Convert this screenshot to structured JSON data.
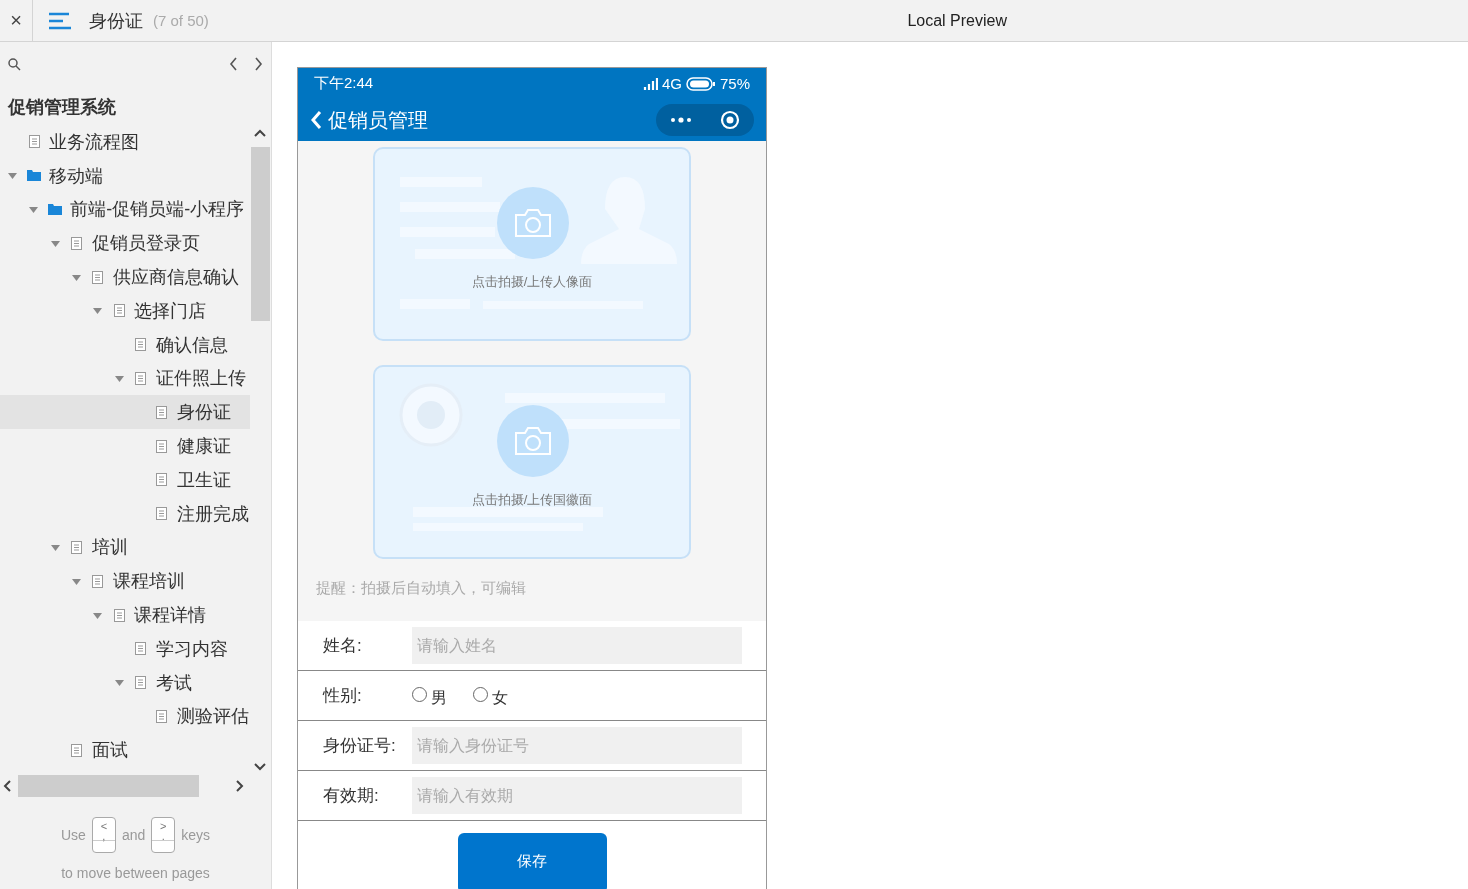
{
  "header": {
    "close": "×",
    "page_title": "身份证",
    "page_count": "(7 of 50)",
    "preview_title": "Local Preview"
  },
  "sidebar": {
    "project_title": "促销管理系统",
    "tree": [
      {
        "label": "业务流程图",
        "kind": "page",
        "selected": false
      },
      {
        "label": "移动端",
        "kind": "folder",
        "selected": false,
        "expanded": true,
        "children": [
          {
            "label": "前端-促销员端-小程序",
            "kind": "folder",
            "selected": false,
            "expanded": true,
            "children": [
              {
                "label": "促销员登录页",
                "kind": "page",
                "selected": false,
                "expanded": true,
                "children": [
                  {
                    "label": "供应商信息确认",
                    "kind": "page",
                    "selected": false,
                    "expanded": true,
                    "children": [
                      {
                        "label": "选择门店",
                        "kind": "page",
                        "selected": false,
                        "expanded": true,
                        "children": [
                          {
                            "label": "确认信息",
                            "kind": "page",
                            "selected": false
                          },
                          {
                            "label": "证件照上传",
                            "kind": "page",
                            "selected": false,
                            "expanded": true,
                            "children": [
                              {
                                "label": "身份证",
                                "kind": "page",
                                "selected": true
                              },
                              {
                                "label": "健康证",
                                "kind": "page",
                                "selected": false
                              },
                              {
                                "label": "卫生证",
                                "kind": "page",
                                "selected": false
                              },
                              {
                                "label": "注册完成",
                                "kind": "page",
                                "selected": false
                              }
                            ]
                          }
                        ]
                      }
                    ]
                  }
                ]
              },
              {
                "label": "培训",
                "kind": "page",
                "selected": false,
                "expanded": true,
                "children": [
                  {
                    "label": "课程培训",
                    "kind": "page",
                    "selected": false,
                    "expanded": true,
                    "children": [
                      {
                        "label": "课程详情",
                        "kind": "page",
                        "selected": false,
                        "expanded": true,
                        "children": [
                          {
                            "label": "学习内容",
                            "kind": "page",
                            "selected": false
                          },
                          {
                            "label": "考试",
                            "kind": "page",
                            "selected": false,
                            "expanded": true,
                            "children": [
                              {
                                "label": "测验评估",
                                "kind": "page",
                                "selected": false
                              }
                            ]
                          }
                        ]
                      }
                    ]
                  }
                ]
              },
              {
                "label": "面试",
                "kind": "page",
                "selected": false
              }
            ]
          }
        ]
      }
    ],
    "hint": {
      "use": "Use",
      "key_prev": {
        "top": "<",
        "bottom": ","
      },
      "and": "and",
      "key_next": {
        "top": ">",
        "bottom": "."
      },
      "keys": "keys",
      "line2": "to move between pages"
    }
  },
  "phone": {
    "time": "下午2:44",
    "network": "4G",
    "battery": "75%",
    "nav_title": "促销员管理",
    "cards": [
      {
        "caption": "点击拍摄/上传人像面",
        "kind": "portrait"
      },
      {
        "caption": "点击拍摄/上传国徽面",
        "kind": "emblem"
      }
    ],
    "notice": "提醒：拍摄后自动填入，可编辑",
    "form": [
      {
        "kind": "input",
        "label": "姓名:",
        "placeholder": "请输入姓名"
      },
      {
        "kind": "radio",
        "label": "性别:",
        "options": [
          {
            "label": "男",
            "selected": false
          },
          {
            "label": "女",
            "selected": false
          }
        ]
      },
      {
        "kind": "input",
        "label": "身份证号:",
        "placeholder": "请输入身份证号"
      },
      {
        "kind": "input",
        "label": "有效期:",
        "placeholder": "请输入有效期"
      }
    ],
    "save_button": "保存"
  }
}
